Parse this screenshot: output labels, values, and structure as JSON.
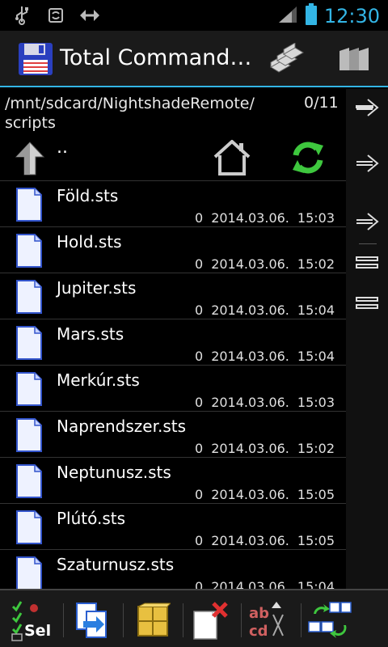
{
  "status_bar": {
    "time": "12:30",
    "icons": [
      "usb-icon",
      "sync-icon",
      "debug-icon",
      "signal-icon",
      "battery-icon"
    ]
  },
  "action_bar": {
    "title": "Total Command…",
    "icons": [
      "floppy-disk-icon",
      "copy-files-icon",
      "bookmarks-icon"
    ]
  },
  "panel": {
    "path": "/mnt/sdcard/NightshadeRemote/\nscripts",
    "count": "0/11",
    "up_label": ".."
  },
  "files": [
    {
      "name": "Föld.sts",
      "size": "0",
      "date": "2014.03.06.",
      "time": "15:03"
    },
    {
      "name": "Hold.sts",
      "size": "0",
      "date": "2014.03.06.",
      "time": "15:02"
    },
    {
      "name": "Jupiter.sts",
      "size": "0",
      "date": "2014.03.06.",
      "time": "15:04"
    },
    {
      "name": "Mars.sts",
      "size": "0",
      "date": "2014.03.06.",
      "time": "15:04"
    },
    {
      "name": "Merkúr.sts",
      "size": "0",
      "date": "2014.03.06.",
      "time": "15:03"
    },
    {
      "name": "Naprendszer.sts",
      "size": "0",
      "date": "2014.03.06.",
      "time": "15:02"
    },
    {
      "name": "Neptunusz.sts",
      "size": "0",
      "date": "2014.03.06.",
      "time": "15:05"
    },
    {
      "name": "Plútó.sts",
      "size": "0",
      "date": "2014.03.06.",
      "time": "15:05"
    },
    {
      "name": "Szaturnusz.sts",
      "size": "0",
      "date": "2014.03.06.",
      "time": "15:04"
    }
  ],
  "toolbar": {
    "select_label": "Sel",
    "rename_label_top": "ab",
    "rename_label_bottom": "cd"
  },
  "colors": {
    "accent": "#33b5e5",
    "refresh_green": "#3ec73e",
    "delete_red": "#e03030"
  }
}
